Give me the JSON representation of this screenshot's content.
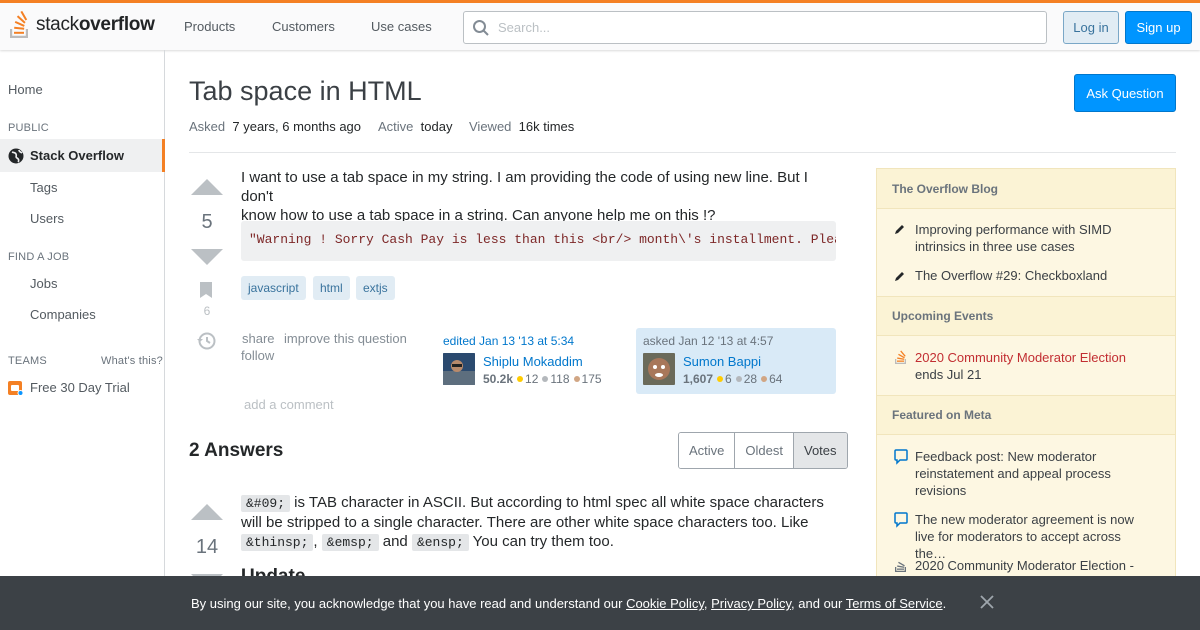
{
  "header": {
    "logo_text_light": "stack",
    "logo_text_bold": "overflow",
    "nav": [
      "Products",
      "Customers",
      "Use cases"
    ],
    "search_placeholder": "Search...",
    "login_label": "Log in",
    "signup_label": "Sign up"
  },
  "sidebar": {
    "home": "Home",
    "public_heading": "PUBLIC",
    "stack_overflow": "Stack Overflow",
    "tags": "Tags",
    "users": "Users",
    "find_job_heading": "FIND A JOB",
    "jobs": "Jobs",
    "companies": "Companies",
    "teams_heading": "TEAMS",
    "whats_this": "What's this?",
    "free_trial": "Free 30 Day Trial"
  },
  "question": {
    "title": "Tab space in HTML",
    "ask_button": "Ask Question",
    "asked_label": "Asked",
    "asked_value": "7 years, 6 months ago",
    "active_label": "Active",
    "active_value": "today",
    "viewed_label": "Viewed",
    "viewed_value": "16k times",
    "votes": "5",
    "bookmark_count": "6",
    "body_line1": "I want to use a tab space in my string. I am providing the code of using new line. But I don't",
    "body_line2": "know how to use a tab space in a string. Can anyone help me on this !?",
    "code": "\"Warning ! Sorry Cash Pay is less than this  <br/> month\\'s installment. Please pay the",
    "tags": [
      "javascript",
      "html",
      "extjs"
    ],
    "menu_share": "share",
    "menu_improve": "improve this question",
    "menu_follow": "follow",
    "edited": {
      "label": "edited Jan 13 '13 at 5:34",
      "user": "Shiplu Mokaddim",
      "rep": "50.2k",
      "gold": "12",
      "silver": "118",
      "bronze": "175"
    },
    "asked": {
      "label": "asked Jan 12 '13 at 4:57",
      "user": "Sumon Bappi",
      "rep": "1,607",
      "gold": "6",
      "silver": "28",
      "bronze": "64"
    },
    "add_comment": "add a comment"
  },
  "answers": {
    "heading": "2 Answers",
    "sort_tabs": [
      "Active",
      "Oldest",
      "Votes"
    ],
    "selected_sort": "Votes",
    "first": {
      "votes": "14",
      "code1": "&#09;",
      "text1": " is TAB character in ASCII. But according to html spec all white space characters",
      "text2": "will be stripped to a single character. There are other white space characters too. Like",
      "code2": "&thinsp;",
      "sep1": ",",
      "code3": "&emsp;",
      "and": "and",
      "code4": "&ensp;",
      "text3": "You can try them too.",
      "update_heading": "Update"
    }
  },
  "right_sidebar": {
    "blog_heading": "The Overflow Blog",
    "blog_items": [
      "Improving performance with SIMD intrinsics in three use cases",
      "The Overflow #29: Checkboxland"
    ],
    "events_heading": "Upcoming Events",
    "event_title": "2020 Community Moderator Election",
    "event_sub": "ends Jul 21",
    "meta_heading": "Featured on Meta",
    "meta_items": [
      "Feedback post: New moderator reinstatement and appeal process revisions",
      "The new moderator agreement is now live for moderators to accept across the…",
      "2020 Community Moderator Election -"
    ]
  },
  "cookie": {
    "text_before": "By using our site, you acknowledge that you have read and understand our ",
    "cookie_policy": "Cookie Policy",
    "comma": ", ",
    "privacy_policy": "Privacy Policy",
    "and_our": ", and our ",
    "terms": "Terms of Service",
    "period": "."
  },
  "colors": {
    "accent": "#f48024",
    "primary_button": "#0095ff",
    "link": "#0077cc"
  }
}
